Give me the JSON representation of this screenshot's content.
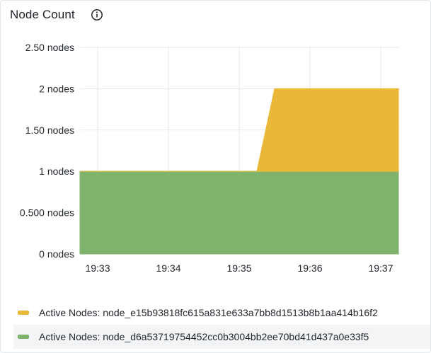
{
  "panel": {
    "title": "Node Count",
    "info_icon": "info-circle-icon"
  },
  "chart_data": {
    "type": "area",
    "stacked": true,
    "xlabel": "",
    "ylabel": "",
    "x_ticks": [
      "19:33",
      "19:34",
      "19:35",
      "19:36",
      "19:37"
    ],
    "y_ticks": [
      "0 nodes",
      "0.500 nodes",
      "1 nodes",
      "1.50 nodes",
      "2 nodes",
      "2.50 nodes"
    ],
    "y_tick_values": [
      0,
      0.5,
      1,
      1.5,
      2,
      2.5
    ],
    "ylim": [
      0,
      2.5
    ],
    "grid": true,
    "legend_position": "bottom",
    "series": [
      {
        "name": "Active Nodes: node_d6a53719754452cc0b3004bb2ee70bd41d437a0e33f5",
        "color": "#7eb26d",
        "values": [
          1,
          1,
          1,
          1,
          1,
          1,
          1,
          1,
          1
        ]
      },
      {
        "name": "Active Nodes: node_e15b93818fc615a831e633a7bb8d1513b8b1aa414b16f2",
        "color": "#eab839",
        "values": [
          0,
          0,
          0,
          0,
          0,
          0,
          1,
          1,
          1
        ]
      }
    ],
    "x_times": [
      "19:32:45",
      "19:33:15",
      "19:33:45",
      "19:34:15",
      "19:34:45",
      "19:35:15",
      "19:35:30",
      "19:36:15",
      "19:37:15"
    ]
  },
  "legend": [
    {
      "label": "Active Nodes: node_e15b93818fc615a831e633a7bb8d1513b8b1aa414b16f2",
      "color": "#eab839"
    },
    {
      "label": "Active Nodes: node_d6a53719754452cc0b3004bb2ee70bd41d437a0e33f5",
      "color": "#7eb26d"
    }
  ]
}
